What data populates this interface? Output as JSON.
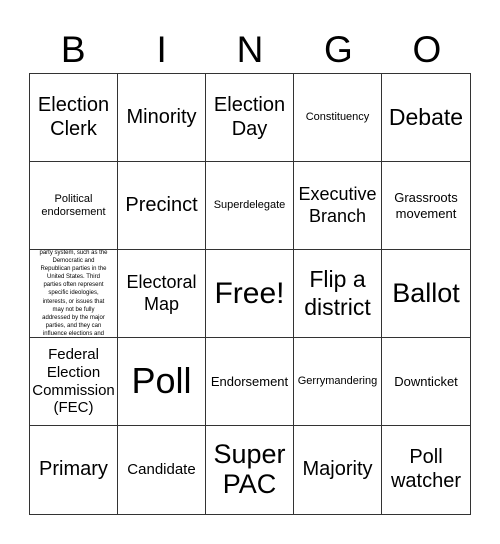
{
  "header": {
    "letters": [
      "B",
      "I",
      "N",
      "G",
      "O"
    ]
  },
  "cells": [
    [
      "Election Clerk",
      "Minority",
      "Election Day",
      "Constituency",
      "Debate"
    ],
    [
      "Political endorsement",
      "Precinct",
      "Superdelegate",
      "Executive Branch",
      "Grassroots movement"
    ],
    [
      "party system, such as the Democratic and Republican parties in the United States. Third parties often represent specific ideologies, interests, or issues that may not be fully addressed by the major parties, and they can influence elections and",
      "Electoral Map",
      "Free!",
      "Flip a district",
      "Ballot"
    ],
    [
      "Federal Election Commission (FEC)",
      "Poll",
      "Endorsement",
      "Gerrymandering",
      "Downticket"
    ],
    [
      "Primary",
      "Candidate",
      "Super PAC",
      "Majority",
      "Poll watcher"
    ]
  ]
}
